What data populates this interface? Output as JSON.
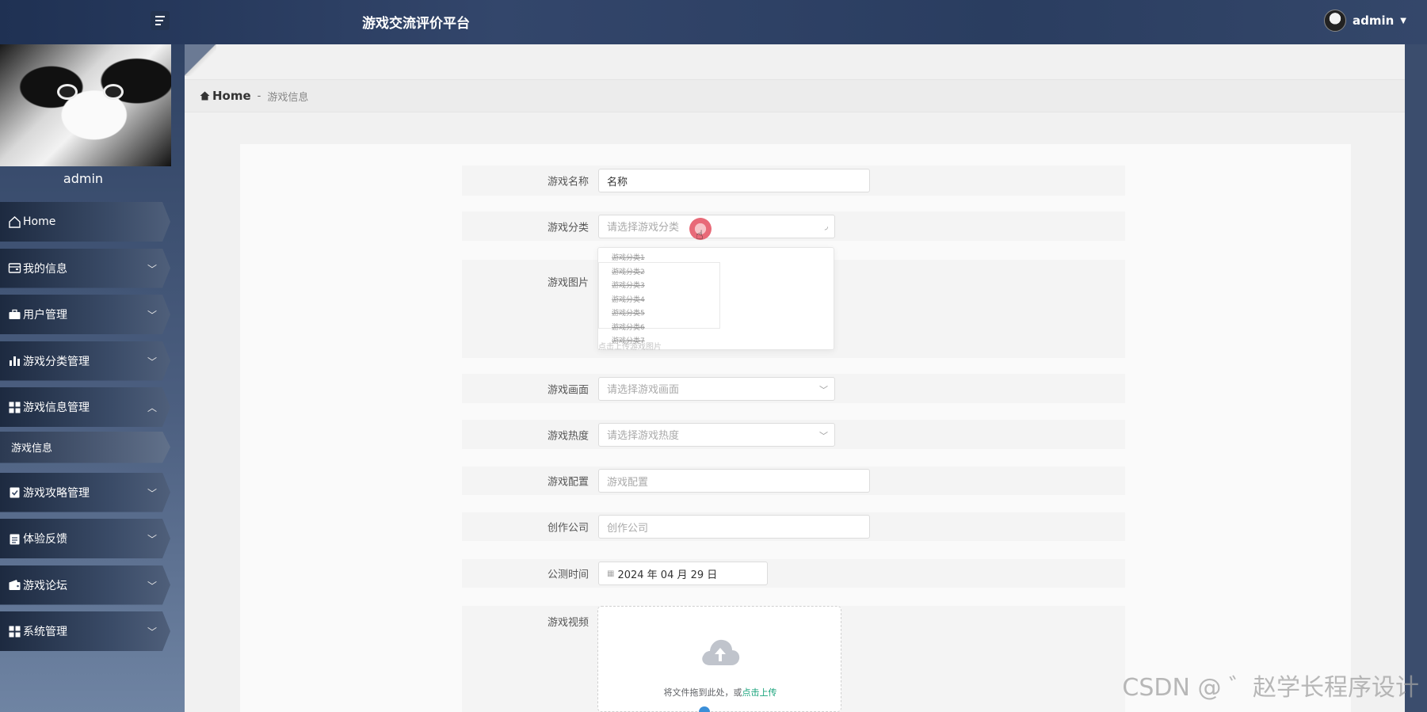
{
  "header": {
    "title": "游戏交流评价平台",
    "user_name": "admin"
  },
  "sidebar": {
    "profile_name": "admin",
    "items": [
      {
        "label": "Home",
        "icon": "home-icon"
      },
      {
        "label": "我的信息",
        "icon": "id-card-icon"
      },
      {
        "label": "用户管理",
        "icon": "briefcase-icon"
      },
      {
        "label": "游戏分类管理",
        "icon": "bar-chart-icon"
      },
      {
        "label": "游戏信息管理",
        "icon": "grid-icon",
        "expanded": true
      },
      {
        "label": "游戏攻略管理",
        "icon": "clipboard-check-icon"
      },
      {
        "label": "体验反馈",
        "icon": "clipboard-icon"
      },
      {
        "label": "游戏论坛",
        "icon": "wallet-icon"
      },
      {
        "label": "系统管理",
        "icon": "grid-icon"
      }
    ],
    "sub_items": [
      {
        "label": "游戏信息"
      }
    ]
  },
  "breadcrumb": {
    "home": "Home",
    "separator": "-",
    "current": "游戏信息"
  },
  "form": {
    "name": {
      "label": "游戏名称",
      "value": "名称"
    },
    "category": {
      "label": "游戏分类",
      "placeholder": "请选择游戏分类"
    },
    "image": {
      "label": "游戏图片",
      "upload_hint": "点击上传游戏图片"
    },
    "graphics": {
      "label": "游戏画面",
      "placeholder": "请选择游戏画面"
    },
    "popularity": {
      "label": "游戏热度",
      "placeholder": "请选择游戏热度"
    },
    "config": {
      "label": "游戏配置",
      "placeholder": "游戏配置"
    },
    "company": {
      "label": "创作公司",
      "placeholder": "创作公司"
    },
    "release_date": {
      "label": "公测时间",
      "value": "2024 年 04 月 29 日"
    },
    "video": {
      "label": "游戏视频",
      "upload_text": "将文件拖到此处，或",
      "upload_link": "点击上传"
    }
  },
  "category_options": [
    "游戏分类1",
    "游戏分类2",
    "游戏分类3",
    "游戏分类4",
    "游戏分类5",
    "游戏分类6",
    "游戏分类7"
  ],
  "watermark": "CSDN @ ゛赵学长程序设计",
  "colors": {
    "topbar": "#2a3d60",
    "accent_link": "#18a37b",
    "click_indicator": "#e86a78"
  }
}
